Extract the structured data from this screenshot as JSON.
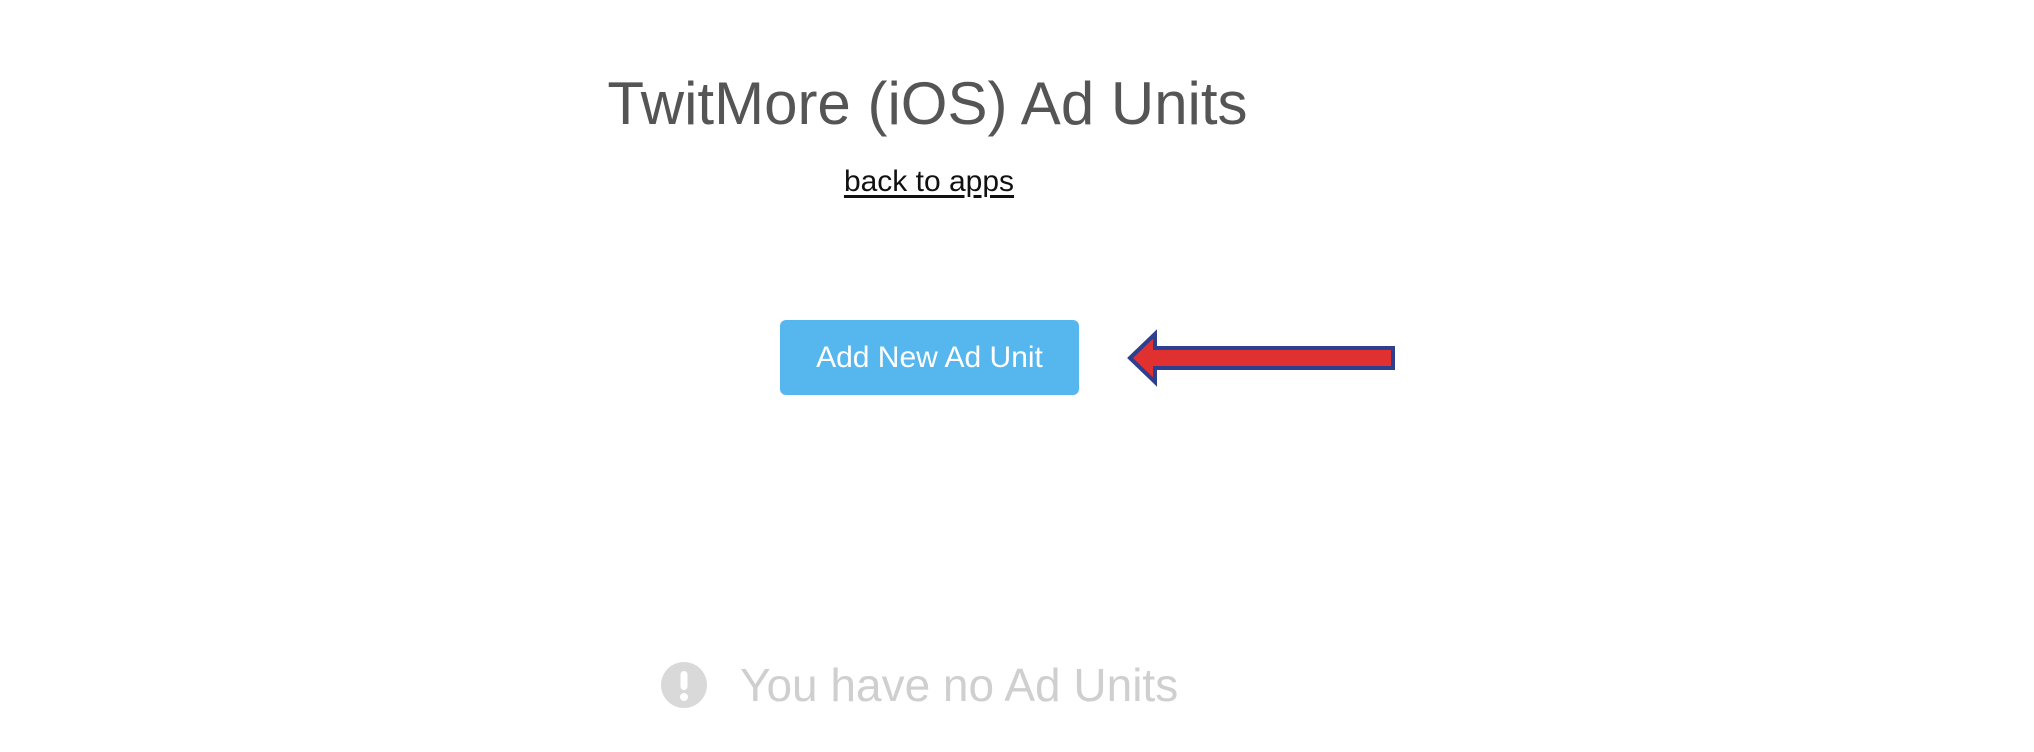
{
  "header": {
    "title": "TwitMore (iOS) Ad Units",
    "back_link_label": "back to apps"
  },
  "actions": {
    "add_button_label": "Add New Ad Unit"
  },
  "annotation": {
    "arrow_fill_color": "#e03030",
    "arrow_stroke_color": "#2e3f8f"
  },
  "empty_state": {
    "icon": "exclamation-circle-icon",
    "message": "You have no Ad Units"
  },
  "colors": {
    "button_bg": "#56b7ee",
    "title_text": "#555555",
    "empty_text": "#cfcfcf"
  }
}
